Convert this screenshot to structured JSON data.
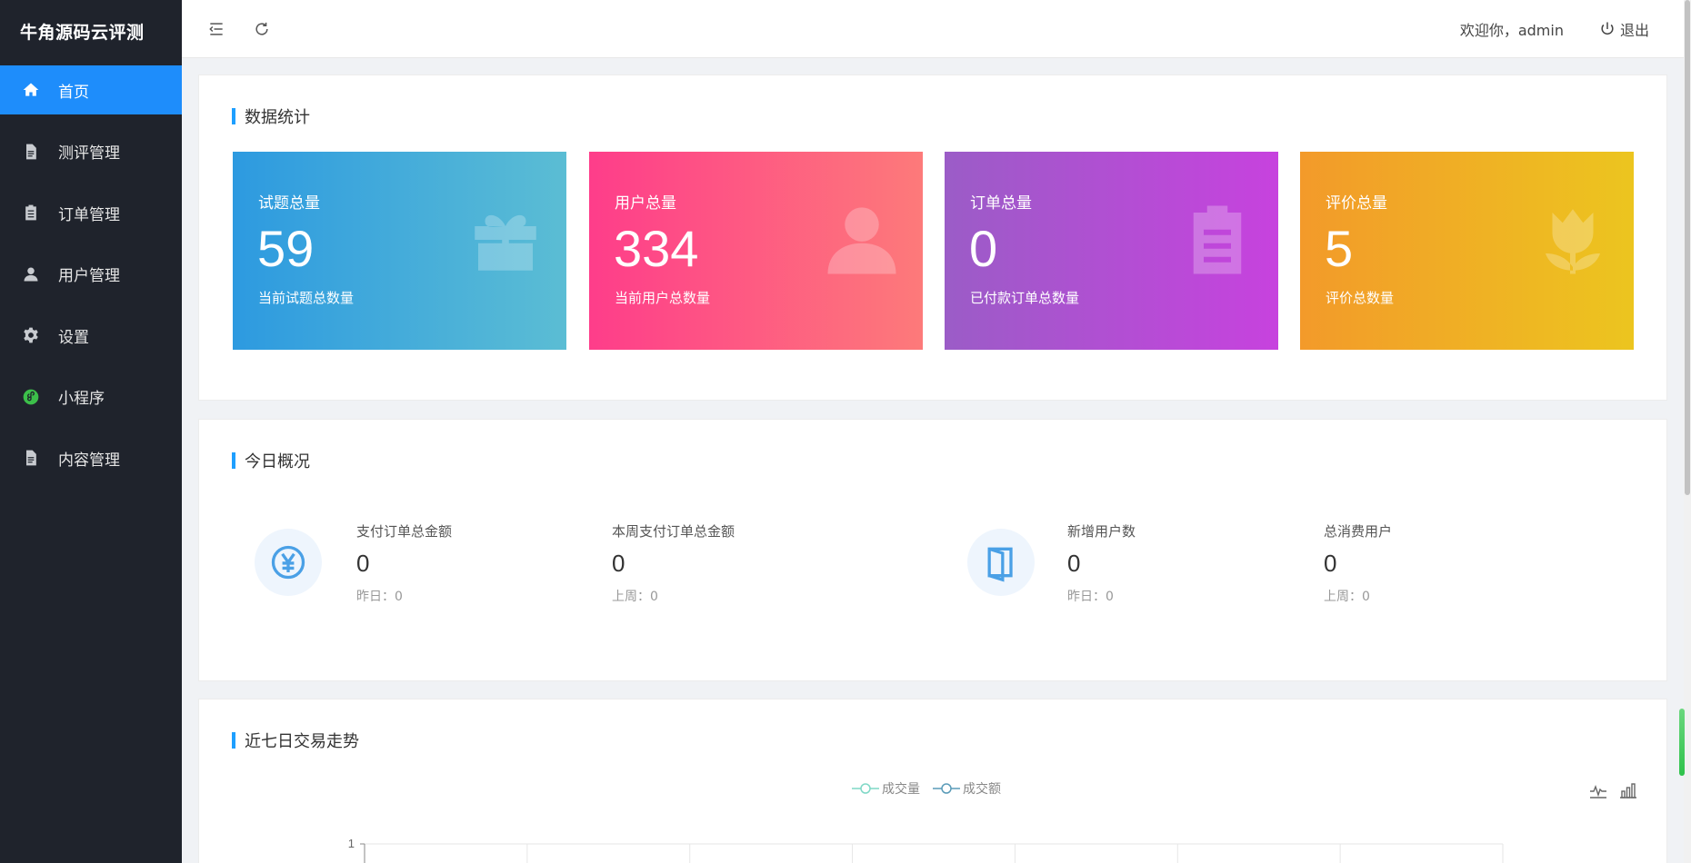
{
  "app": {
    "brand": "牛角源码云评测"
  },
  "sidebar": {
    "items": [
      {
        "label": "首页",
        "icon": "home-icon",
        "active": true
      },
      {
        "label": "测评管理",
        "icon": "document-icon"
      },
      {
        "label": "订单管理",
        "icon": "clipboard-icon"
      },
      {
        "label": "用户管理",
        "icon": "user-icon"
      },
      {
        "label": "设置",
        "icon": "gear-icon"
      },
      {
        "label": "小程序",
        "icon": "miniprogram-icon"
      },
      {
        "label": "内容管理",
        "icon": "document-icon"
      }
    ]
  },
  "header": {
    "menu_toggle_icon": "menu-fold-icon",
    "refresh_icon": "refresh-icon",
    "welcome": "欢迎你，admin",
    "logout_label": "退出",
    "logout_icon": "power-icon"
  },
  "stats": {
    "title": "数据统计",
    "cards": [
      {
        "title": "试题总量",
        "value": "59",
        "sub": "当前试题总数量",
        "icon": "gift-icon",
        "colors": [
          "#2d9ae0",
          "#5bbdd4"
        ]
      },
      {
        "title": "用户总量",
        "value": "334",
        "sub": "当前用户总数量",
        "icon": "user-icon",
        "colors": [
          "#fe3d8a",
          "#fd7a7a"
        ]
      },
      {
        "title": "订单总量",
        "value": "0",
        "sub": "已付款订单总数量",
        "icon": "clipboard-icon",
        "colors": [
          "#9b5cc7",
          "#c742de"
        ]
      },
      {
        "title": "评价总量",
        "value": "5",
        "sub": "评价总数量",
        "icon": "tulip-icon",
        "colors": [
          "#f39a2a",
          "#ecc51f"
        ]
      }
    ]
  },
  "today": {
    "title": "今日概况",
    "items": [
      {
        "label": "支付订单总金额",
        "value": "0",
        "sub": "昨日：0"
      },
      {
        "label": "本周支付订单总金额",
        "value": "0",
        "sub": "上周：0"
      },
      {
        "label": "新增用户数",
        "value": "0",
        "sub": "昨日：0"
      },
      {
        "label": "总消费用户",
        "value": "0",
        "sub": "上周：0"
      }
    ],
    "icons": [
      "yuan-icon",
      "door-icon"
    ]
  },
  "trend": {
    "title": "近七日交易走势",
    "toolbox": [
      "line-chart-icon",
      "bar-chart-icon"
    ]
  },
  "chart_data": {
    "type": "line",
    "series": [
      {
        "name": "成交量",
        "color": "#7fd8c6",
        "values": []
      },
      {
        "name": "成交额",
        "color": "#5a9bb8",
        "values": []
      }
    ],
    "y_ticks": [
      "1"
    ],
    "legend": "top-center",
    "grid": true
  },
  "accent": "#1e8dfb"
}
